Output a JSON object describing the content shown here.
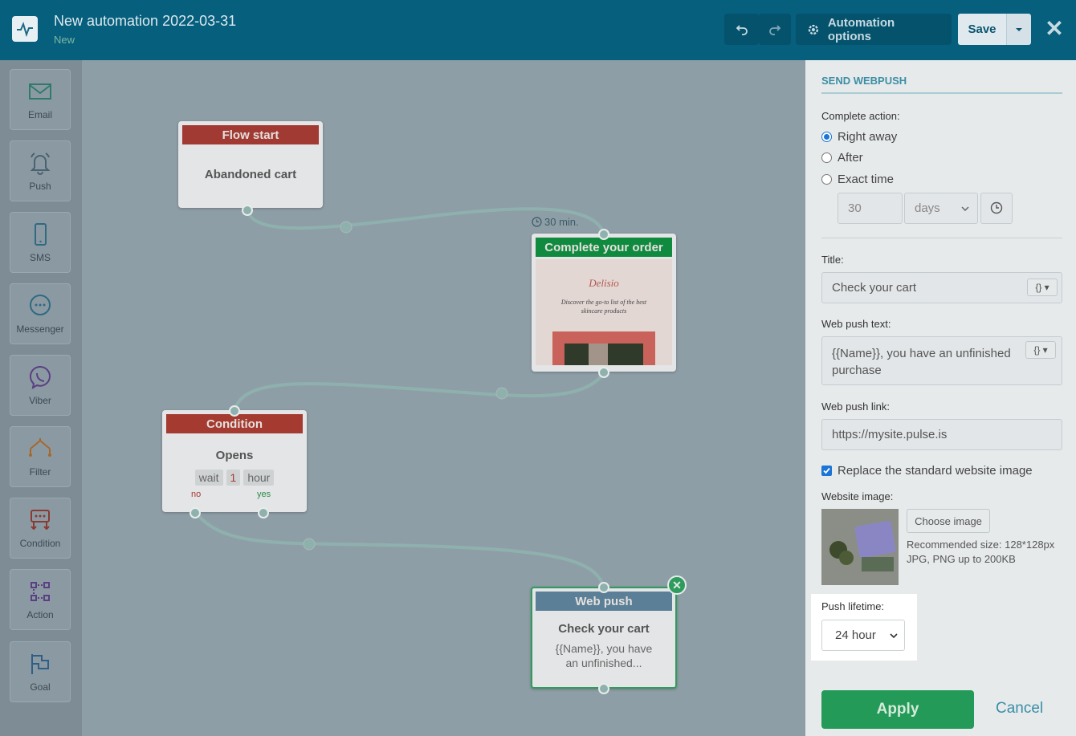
{
  "header": {
    "title": "New automation 2022-03-31",
    "status": "New",
    "automation_options_label": "Automation options",
    "save_label": "Save"
  },
  "toolbar": {
    "items": [
      {
        "label": "Email",
        "icon": "envelope-icon"
      },
      {
        "label": "Push",
        "icon": "bell-icon"
      },
      {
        "label": "SMS",
        "icon": "phone-icon"
      },
      {
        "label": "Messenger",
        "icon": "chat-icon"
      },
      {
        "label": "Viber",
        "icon": "viber-icon"
      },
      {
        "label": "Filter",
        "icon": "filter-icon"
      },
      {
        "label": "Condition",
        "icon": "condition-icon"
      },
      {
        "label": "Action",
        "icon": "action-icon"
      },
      {
        "label": "Goal",
        "icon": "flag-icon"
      }
    ]
  },
  "canvas": {
    "flow_start": {
      "header": "Flow start",
      "body": "Abandoned cart"
    },
    "delay_label": "30 min.",
    "complete_order": {
      "header": "Complete your order",
      "preview_brand": "Delisio",
      "preview_text": "Discover the go-to list of the best skincare products"
    },
    "condition": {
      "header": "Condition",
      "body": "Opens",
      "wait": "wait",
      "count": "1",
      "unit": "hour",
      "no": "no",
      "yes": "yes"
    },
    "web_push": {
      "header": "Web push",
      "title": "Check your cart",
      "text": "{{Name}}, you have an unfinished..."
    }
  },
  "panel": {
    "title": "SEND WEBPUSH",
    "complete_action_label": "Complete action:",
    "options": [
      "Right away",
      "After",
      "Exact time"
    ],
    "selected_option": "Right away",
    "delay_value": "30",
    "delay_unit": "days",
    "title_label": "Title:",
    "title_value": "Check your cart",
    "text_label": "Web push text:",
    "text_value": "{{Name}}, you have an unfinished purchase",
    "link_label": "Web push link:",
    "link_value": "https://mysite.pulse.is",
    "replace_image_label": "Replace the standard website image",
    "replace_image_checked": true,
    "website_image_label": "Website image:",
    "choose_image_label": "Choose image",
    "recommended_size": "Recommended size: 128*128px",
    "formats": "JPG, PNG up to 200KB",
    "lifetime_label": "Push lifetime:",
    "lifetime_value": "24 hour",
    "apply_label": "Apply",
    "cancel_label": "Cancel"
  },
  "colors": {
    "header_bg": "#055f7d",
    "flow_start": "#a03a33",
    "complete_order": "#108a3e",
    "condition": "#a43a30",
    "web_push": "#5a7f96",
    "apply": "#239a57"
  }
}
